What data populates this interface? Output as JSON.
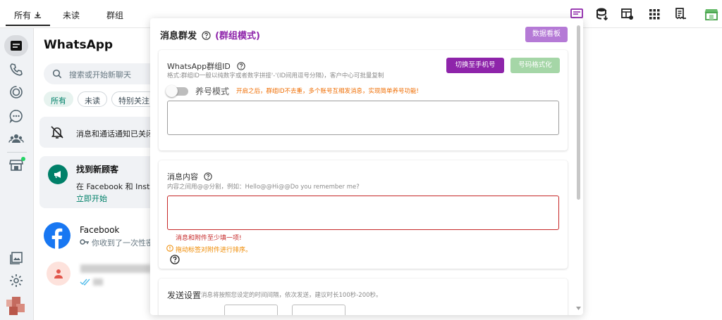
{
  "topbar": {
    "tabs": [
      "所有",
      "未读",
      "群组"
    ]
  },
  "chat_panel": {
    "title": "WhatsApp",
    "search_placeholder": "搜索或开始新聊天",
    "filters": [
      "所有",
      "未读",
      "特别关注"
    ],
    "notice_text": "消息和通话通知已关闭",
    "promo": {
      "title": "找到新顾客",
      "body": "在 Facebook 和 Insta",
      "link": "立即开始"
    },
    "chats": [
      {
        "name": "Facebook",
        "preview": "你收到了一次性密"
      }
    ]
  },
  "modal": {
    "title": "消息群发",
    "mode": "(群组模式)",
    "dashboard_button": "数据看板",
    "group_section": {
      "label": "WhatsApp群组ID",
      "hint": "格式:群组ID一般以纯数字或者数字拼接'-'(ID间用逗号分隔)，客户中心可批量复制",
      "switch_button": "切换至手机号",
      "format_button": "号码格式化",
      "toggle_label": "养号模式",
      "toggle_hint": "开启之后，群组ID不去重，多个账号互相发消息，实现简单养号功能!",
      "value": ""
    },
    "content_section": {
      "label": "消息内容",
      "hint": "内容之间用@@分割，例如：Hello@@Hi@@Do you remember me?",
      "value": "",
      "error": "消息和附件至少填一项!",
      "warning": "拖动标签对附件进行排序。"
    },
    "send_section": {
      "label": "发送设置",
      "hint": "消息将按照您设定的时间间隔，依次发送，建议时长100秒-200秒。"
    }
  },
  "colors": {
    "purple": "#8e24aa",
    "purple_light": "#b57ad6",
    "green_light": "#a5d6a7",
    "error": "#c62828",
    "warning": "#ef8a00",
    "whatsapp_green": "#008069"
  }
}
